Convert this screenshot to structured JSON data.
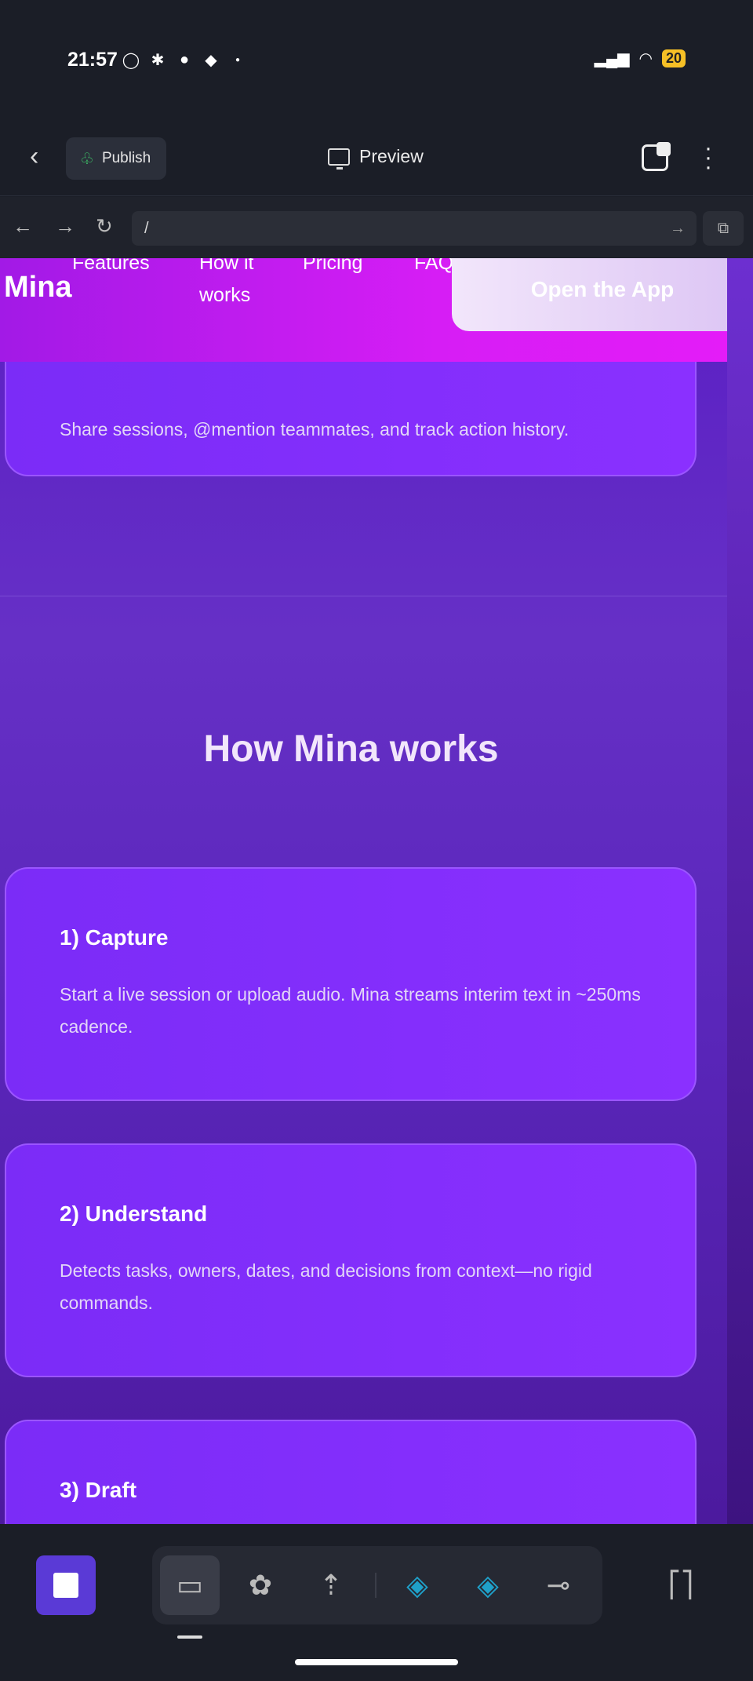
{
  "status": {
    "time": "21:57",
    "battery": "20",
    "icons": [
      "whatsapp-icon",
      "slack-icon",
      "chat-icon",
      "snapchat-icon",
      "dot-icon"
    ]
  },
  "toolbar": {
    "publish_label": "Publish",
    "preview_label": "Preview"
  },
  "browser": {
    "url": "/"
  },
  "site": {
    "logo": "Mina",
    "nav": [
      "Features",
      "How it works",
      "Pricing",
      "FAQ"
    ],
    "cta": "Open the App",
    "collab_text": "Share sessions, @mention teammates, and track action history.",
    "section_title": "How Mina works",
    "steps": [
      {
        "title": "1) Capture",
        "text": "Start a live session or upload audio. Mina streams interim text in ~250ms cadence."
      },
      {
        "title": "2) Understand",
        "text": "Detects tasks, owners, dates, and decisions from context—no rigid commands."
      },
      {
        "title": "3) Draft",
        "text": ""
      }
    ]
  },
  "dock": {
    "tools": [
      "desktop-icon",
      "apps-icon",
      "deploy-icon",
      "python-icon",
      "python-icon",
      "workflow-icon"
    ],
    "panel_icon": "panel-toggle-icon"
  }
}
